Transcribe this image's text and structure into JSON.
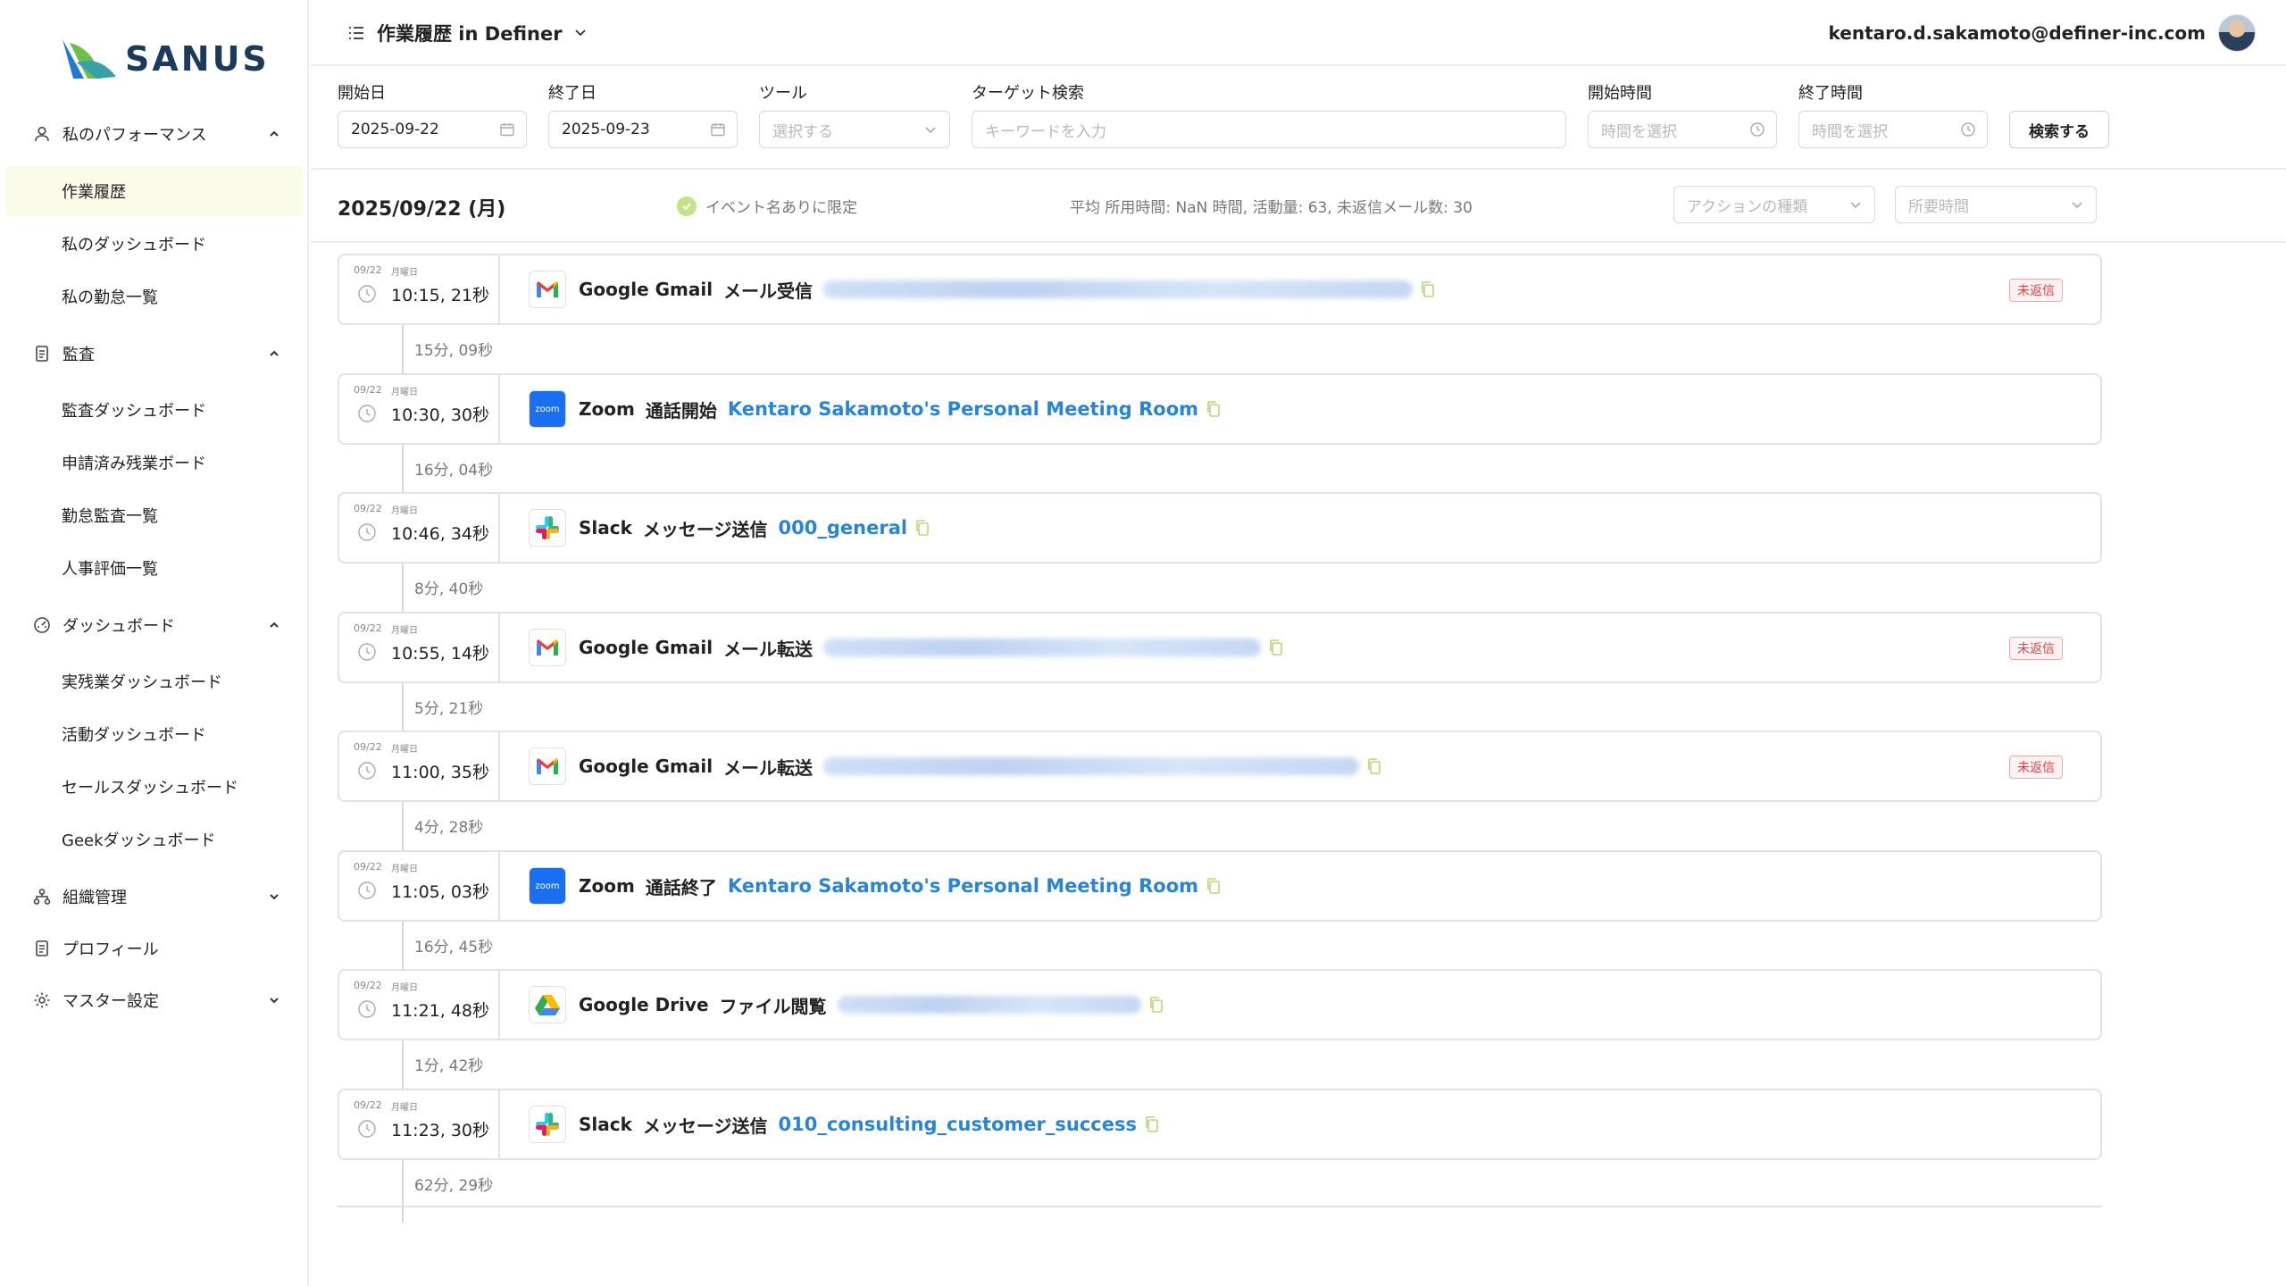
{
  "app": {
    "logo_text": "SANUS",
    "brand_green": "#6cc04a",
    "brand_blue": "#1f7bd1"
  },
  "header": {
    "title": "作業履歴 in Definer",
    "user_email": "kentaro.d.sakamoto@definer-inc.com"
  },
  "sidebar": {
    "sections": [
      {
        "label": "私のパフォーマンス",
        "icon": "person-icon",
        "expanded": true,
        "items": [
          "作業履歴",
          "私のダッシュボード",
          "私の勤怠一覧"
        ]
      },
      {
        "label": "監査",
        "icon": "document-icon",
        "expanded": true,
        "items": [
          "監査ダッシュボード",
          "申請済み残業ボード",
          "勤怠監査一覧",
          "人事評価一覧"
        ]
      },
      {
        "label": "ダッシュボード",
        "icon": "gauge-icon",
        "expanded": true,
        "items": [
          "実残業ダッシュボード",
          "活動ダッシュボード",
          "セールスダッシュボード",
          "Geekダッシュボード"
        ]
      },
      {
        "label": "組織管理",
        "icon": "org-icon",
        "expanded": false,
        "items": []
      },
      {
        "label": "プロフィール",
        "icon": "profile-icon",
        "expanded": false,
        "items": []
      },
      {
        "label": "マスター設定",
        "icon": "gear-icon",
        "expanded": false,
        "items": []
      }
    ],
    "active_item": "作業履歴"
  },
  "filters": {
    "start_date": {
      "label": "開始日",
      "value": "2025-09-22"
    },
    "end_date": {
      "label": "終了日",
      "value": "2025-09-23"
    },
    "tool": {
      "label": "ツール",
      "placeholder": "選択する"
    },
    "target_search": {
      "label": "ターゲット検索",
      "placeholder": "キーワードを入力"
    },
    "start_time": {
      "label": "開始時間",
      "placeholder": "時間を選択"
    },
    "end_time": {
      "label": "終了時間",
      "placeholder": "時間を選択"
    },
    "search_button": "検索する"
  },
  "summary": {
    "date_title": "2025/09/22 (月)",
    "limit_label": "イベント名ありに限定",
    "stats": "平均 所用時間: NaN 時間, 活動量: 63, 未返信メール数: 30",
    "action_type_placeholder": "アクションの種類",
    "duration_placeholder": "所要時間"
  },
  "events": [
    {
      "date": "09/22",
      "weekday": "月曜日",
      "time": "10:15, 21秒",
      "app": "Google Gmail",
      "icon": "gmail-icon",
      "action": "メール受信",
      "target": "",
      "badge": "未返信"
    },
    {
      "date": "09/22",
      "weekday": "月曜日",
      "time": "10:30, 30秒",
      "app": "Zoom",
      "icon": "zoom-icon",
      "action": "通話開始",
      "target": "Kentaro Sakamoto's Personal Meeting Room",
      "badge": ""
    },
    {
      "date": "09/22",
      "weekday": "月曜日",
      "time": "10:46, 34秒",
      "app": "Slack",
      "icon": "slack-icon",
      "action": "メッセージ送信",
      "target": "000_general",
      "badge": ""
    },
    {
      "date": "09/22",
      "weekday": "月曜日",
      "time": "10:55, 14秒",
      "app": "Google Gmail",
      "icon": "gmail-icon",
      "action": "メール転送",
      "target": "",
      "badge": "未返信"
    },
    {
      "date": "09/22",
      "weekday": "月曜日",
      "time": "11:00, 35秒",
      "app": "Google Gmail",
      "icon": "gmail-icon",
      "action": "メール転送",
      "target": "",
      "badge": "未返信"
    },
    {
      "date": "09/22",
      "weekday": "月曜日",
      "time": "11:05, 03秒",
      "app": "Zoom",
      "icon": "zoom-icon",
      "action": "通話終了",
      "target": "Kentaro Sakamoto's Personal Meeting Room",
      "badge": ""
    },
    {
      "date": "09/22",
      "weekday": "月曜日",
      "time": "11:21, 48秒",
      "app": "Google Drive",
      "icon": "gdrive-icon",
      "action": "ファイル閲覧",
      "target": "",
      "badge": ""
    },
    {
      "date": "09/22",
      "weekday": "月曜日",
      "time": "11:23, 30秒",
      "app": "Slack",
      "icon": "slack-icon",
      "action": "メッセージ送信",
      "target": "010_consulting_customer_success",
      "badge": ""
    }
  ],
  "gaps": [
    "15分, 09秒",
    "16分, 04秒",
    "8分, 40秒",
    "5分, 21秒",
    "4分, 28秒",
    "16分, 45秒",
    "1分, 42秒",
    "62分, 29秒"
  ]
}
